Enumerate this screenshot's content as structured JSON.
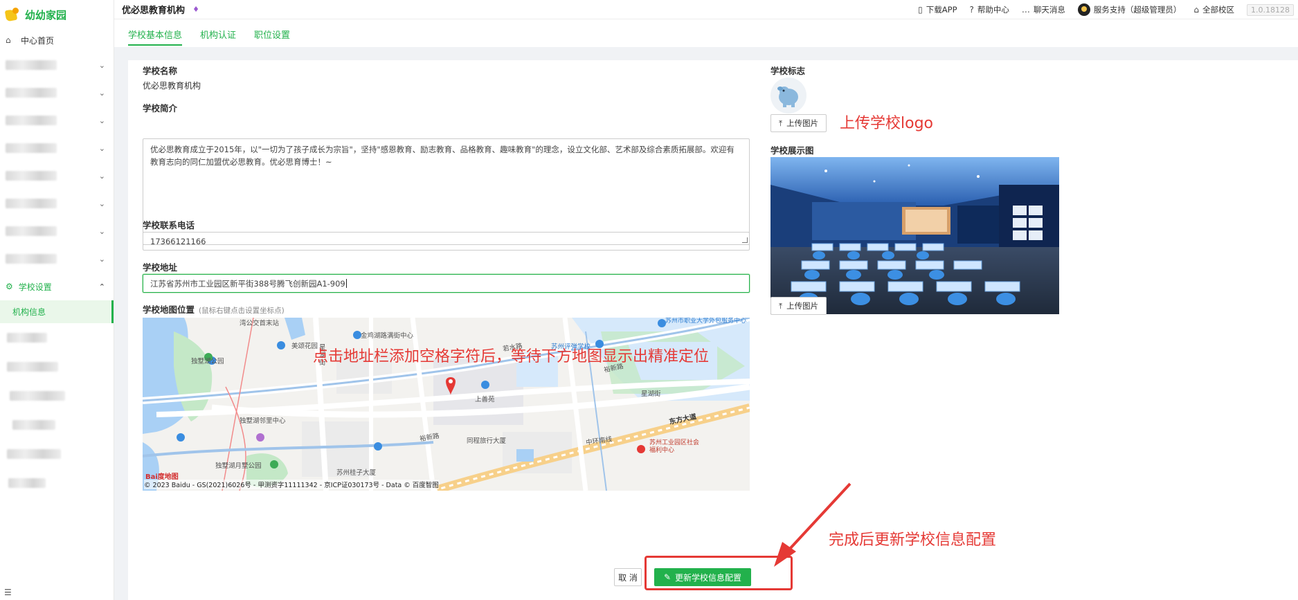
{
  "app": {
    "name": "幼幼家园"
  },
  "sidebar": {
    "home_label": "中心首页",
    "blurred_items_count": 8,
    "group_label": "学校设置",
    "active_item": "机构信息"
  },
  "header": {
    "org_name": "优必思教育机构",
    "download_app": "下载APP",
    "help_center": "帮助中心",
    "chat_messages": "聊天消息",
    "user": "服务支持（超级管理员）",
    "campus": "全部校区",
    "version": "1.0.18128"
  },
  "tabs": [
    {
      "label": "学校基本信息",
      "active": true
    },
    {
      "label": "机构认证",
      "active": false
    },
    {
      "label": "职位设置",
      "active": false
    }
  ],
  "form": {
    "name_label": "学校名称",
    "name_value": "优必思教育机构",
    "intro_label": "学校简介",
    "intro_value": "优必思教育成立于2015年，以\"一切为了孩子成长为宗旨\"，坚持\"感恩教育、励志教育、品格教育、趣味教育\"的理念，设立文化部、艺术部及综合素质拓展部。欢迎有教育志向的同仁加盟优必思教育。优必思育博士！~",
    "phone_label": "学校联系电话",
    "phone_value": "17366121166",
    "address_label": "学校地址",
    "address_value": "江苏省苏州市工业园区新平街388号腾飞创新园A1-909",
    "map_label": "学校地图位置",
    "map_hint": "(鼠标右键点击设置坐标点)",
    "map_copyright": "© 2023 Baidu - GS(2021)6026号 - 甲测资字11111342 - 京ICP证030173号 - Data © 百度智图",
    "map_places": [
      "湾公交首末站",
      "金鸡湖路满街中心",
      "美颂花园",
      "若水路",
      "苏州评弹学校",
      "裕新路",
      "苏州市职业大学外包服务中心",
      "独墅湖公园",
      "星湖街",
      "上善苑",
      "独墅湖邻里中心",
      "东方大道",
      "裕新路",
      "同程旅行大厦",
      "中环南线",
      "苏州工业园区社会福利中心",
      "独墅湖月墅公园",
      "苏州桂子大厦",
      "星湖街"
    ],
    "map_logo": "Bai度地图"
  },
  "right": {
    "logo_label": "学校标志",
    "upload_label": "上传图片",
    "display_label": "学校展示图",
    "upload_label_2": "上传图片"
  },
  "annotations": {
    "upload_logo": "上传学校logo",
    "address_tip": "点击地址栏添加空格字符后，等待下方地图显示出精准定位",
    "finish_tip": "完成后更新学校信息配置"
  },
  "actions": {
    "cancel": "取 消",
    "update": "更新学校信息配置"
  },
  "colors": {
    "brand": "#22b14c",
    "annotation": "#e53935"
  }
}
